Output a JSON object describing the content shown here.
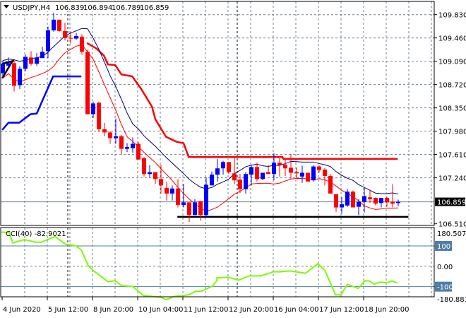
{
  "header": {
    "symbol": "USDJPY,H4",
    "open": "106.839",
    "high": "106.894",
    "low": "106.789",
    "close": "106.859"
  },
  "colors": {
    "bull": "#0000ff",
    "bear": "#ff0000",
    "ma_high": "#000080",
    "ma_low": "#ff0000",
    "cci": "#7cfc00",
    "grid": "#708090",
    "level": "#4d7ea8"
  },
  "chart_data": [
    {
      "type": "candlestick",
      "title": "USDJPY,H4",
      "ylim": [
        106.51,
        109.83
      ],
      "y_ticks": [
        "109.830",
        "109.460",
        "109.090",
        "108.720",
        "108.350",
        "107.980",
        "107.610",
        "107.240",
        "106.859",
        "106.510"
      ],
      "y_tick_values": [
        109.83,
        109.46,
        109.09,
        108.72,
        108.35,
        107.98,
        107.61,
        107.24,
        106.51
      ],
      "current_price": 106.859,
      "x_labels": [
        "4 Jun 2020",
        "5 Jun 12:00",
        "8 Jun 20:00",
        "10 Jun 04:00",
        "11 Jun 12:00",
        "12 Jun 20:00",
        "16 Jun 04:00",
        "17 Jun 12:00",
        "18 Jun 20:00"
      ],
      "x_label_candle_index": [
        0,
        8,
        16,
        24,
        32,
        40,
        48,
        56,
        64
      ],
      "ohlc": [
        [
          108.9,
          109.1,
          108.82,
          109.05
        ],
        [
          109.02,
          109.15,
          108.97,
          109.06
        ],
        [
          109.06,
          109.09,
          108.61,
          108.7
        ],
        [
          108.71,
          109.01,
          108.65,
          108.97
        ],
        [
          108.97,
          109.2,
          108.93,
          109.16
        ],
        [
          109.15,
          109.25,
          109.02,
          109.05
        ],
        [
          109.05,
          109.22,
          109.02,
          109.15
        ],
        [
          109.14,
          109.32,
          109.14,
          109.24
        ],
        [
          109.25,
          109.64,
          109.14,
          109.58
        ],
        [
          109.58,
          109.86,
          109.56,
          109.75
        ],
        [
          109.75,
          109.75,
          109.56,
          109.57
        ],
        [
          109.57,
          109.7,
          109.42,
          109.46
        ],
        [
          109.46,
          109.56,
          109.37,
          109.45
        ],
        [
          109.45,
          109.54,
          109.43,
          109.49
        ],
        [
          109.48,
          109.52,
          109.19,
          109.24
        ],
        [
          109.24,
          109.27,
          108.25,
          108.25
        ],
        [
          108.25,
          108.45,
          108.19,
          108.42
        ],
        [
          108.43,
          108.45,
          107.97,
          108.01
        ],
        [
          108.01,
          108.11,
          107.9,
          107.96
        ],
        [
          107.96,
          107.98,
          107.78,
          107.87
        ],
        [
          107.87,
          108.18,
          107.78,
          107.9
        ],
        [
          107.9,
          107.92,
          107.61,
          107.7
        ],
        [
          107.7,
          107.79,
          107.65,
          107.73
        ],
        [
          107.71,
          107.88,
          107.64,
          107.78
        ],
        [
          107.78,
          107.81,
          107.53,
          107.53
        ],
        [
          107.55,
          107.57,
          107.26,
          107.3
        ],
        [
          107.3,
          107.44,
          107.25,
          107.33
        ],
        [
          107.33,
          107.33,
          107.14,
          107.22
        ],
        [
          107.22,
          107.45,
          106.99,
          107.12
        ],
        [
          107.08,
          107.18,
          106.88,
          106.99
        ],
        [
          106.99,
          107.12,
          106.88,
          107.07
        ],
        [
          107.07,
          107.22,
          106.77,
          106.81
        ],
        [
          106.81,
          107.14,
          106.77,
          106.85
        ],
        [
          106.85,
          106.85,
          106.54,
          106.65
        ],
        [
          106.65,
          106.9,
          106.65,
          106.85
        ],
        [
          106.87,
          106.87,
          106.56,
          106.65
        ],
        [
          106.65,
          107.25,
          106.61,
          107.13
        ],
        [
          107.12,
          107.34,
          107.12,
          107.29
        ],
        [
          107.29,
          107.54,
          107.18,
          107.39
        ],
        [
          107.39,
          107.51,
          107.29,
          107.49
        ],
        [
          107.49,
          107.49,
          107.3,
          107.33
        ],
        [
          107.31,
          107.57,
          107.14,
          107.2
        ],
        [
          107.21,
          107.3,
          107.0,
          107.06
        ],
        [
          107.06,
          107.33,
          106.99,
          107.3
        ],
        [
          107.29,
          107.44,
          107.12,
          107.41
        ],
        [
          107.41,
          107.48,
          107.18,
          107.22
        ],
        [
          107.22,
          107.32,
          107.2,
          107.32
        ],
        [
          107.33,
          107.44,
          107.3,
          107.3
        ],
        [
          107.3,
          107.63,
          107.2,
          107.48
        ],
        [
          107.48,
          107.55,
          107.26,
          107.44
        ],
        [
          107.45,
          107.53,
          107.27,
          107.39
        ],
        [
          107.4,
          107.62,
          107.22,
          107.32
        ],
        [
          107.33,
          107.4,
          107.22,
          107.31
        ],
        [
          107.26,
          107.43,
          107.16,
          107.32
        ],
        [
          107.32,
          107.32,
          107.18,
          107.18
        ],
        [
          107.2,
          107.44,
          107.18,
          107.42
        ],
        [
          107.42,
          107.44,
          107.32,
          107.36
        ],
        [
          107.37,
          107.4,
          107.12,
          107.27
        ],
        [
          107.27,
          107.3,
          106.99,
          106.99
        ],
        [
          106.98,
          106.98,
          106.7,
          106.77
        ],
        [
          106.77,
          106.93,
          106.67,
          106.82
        ],
        [
          106.8,
          107.06,
          106.78,
          107.02
        ],
        [
          107.02,
          107.04,
          106.77,
          106.77
        ],
        [
          106.78,
          106.9,
          106.65,
          106.86
        ],
        [
          106.86,
          107.08,
          106.69,
          106.95
        ],
        [
          106.93,
          107.05,
          106.84,
          106.9
        ],
        [
          106.92,
          106.93,
          106.8,
          106.83
        ],
        [
          106.84,
          106.92,
          106.77,
          106.92
        ],
        [
          106.92,
          106.94,
          106.78,
          106.85
        ],
        [
          106.86,
          107.14,
          106.77,
          106.83
        ],
        [
          106.839,
          106.894,
          106.789,
          106.859
        ]
      ],
      "overlays": {
        "thick_red": [
          [
            14.9,
            109.38
          ],
          [
            16.6,
            109.29
          ],
          [
            17.9,
            109.18
          ],
          [
            18.6,
            109.04
          ],
          [
            19.9,
            109.03
          ],
          [
            21,
            108.88
          ],
          [
            22.9,
            108.85
          ],
          [
            24.5,
            108.65
          ],
          [
            26.4,
            108.37
          ],
          [
            27,
            108.17
          ],
          [
            28.9,
            107.89
          ],
          [
            30.8,
            107.81
          ],
          [
            32,
            107.79
          ],
          [
            32.9,
            107.57
          ],
          [
            49.5,
            107.57
          ],
          [
            49.7,
            107.54
          ],
          [
            69.9,
            107.54
          ]
        ],
        "thick_blue": [
          [
            -0.1,
            108.0
          ],
          [
            1,
            108.115
          ],
          [
            2.9,
            108.115
          ],
          [
            4.9,
            108.25
          ],
          [
            6,
            108.26
          ],
          [
            8.9,
            108.85
          ],
          [
            13.9,
            108.85
          ]
        ],
        "black_lines": [
          [
            [
              -0.1,
              108.82
            ],
            [
              1.75,
              109.1
            ]
          ],
          [
            [
              -0.1,
              109.05
            ],
            [
              2,
              109.1
            ]
          ]
        ],
        "support_line": {
          "price": 106.62,
          "from_index": 30.9,
          "to_index": 71.8
        }
      },
      "period_separators_index": [
        11,
        41
      ]
    },
    {
      "type": "line",
      "title": "CCI(40)",
      "current_value": "-82.9021",
      "label": "CCI(40) -82.9021",
      "ylim": [
        -180.8812,
        180.5073
      ],
      "y_ticks": [
        "180.5073",
        "100",
        "0.00",
        "-100",
        "-180.8812"
      ],
      "levels": [
        100,
        -100
      ],
      "points": [
        [
          -0.25,
          167
        ],
        [
          1.1,
          167
        ],
        [
          1.75,
          115
        ],
        [
          3.9,
          131
        ],
        [
          5.75,
          118
        ],
        [
          6.75,
          118
        ],
        [
          9.25,
          146
        ],
        [
          11.1,
          108
        ],
        [
          12.9,
          101
        ],
        [
          13.9,
          80
        ],
        [
          15.1,
          4
        ],
        [
          16.1,
          -23
        ],
        [
          18.6,
          -75
        ],
        [
          19.9,
          -71
        ],
        [
          21,
          -95
        ],
        [
          23,
          -99
        ],
        [
          24.9,
          -144
        ],
        [
          27.9,
          -151
        ],
        [
          28.9,
          -164
        ],
        [
          30.4,
          -148
        ],
        [
          32.9,
          -140
        ],
        [
          34.1,
          -123
        ],
        [
          35.1,
          -123
        ],
        [
          37,
          -99
        ],
        [
          37.9,
          -71
        ],
        [
          37.9,
          -71
        ],
        [
          37.9,
          -57
        ],
        [
          39.9,
          -54
        ],
        [
          41.75,
          -68
        ],
        [
          43.6,
          -47
        ],
        [
          45.75,
          -47
        ],
        [
          47.9,
          -27
        ],
        [
          49.1,
          -27
        ],
        [
          50.75,
          -23
        ],
        [
          53.6,
          -34
        ],
        [
          55.75,
          12
        ],
        [
          57,
          -19
        ],
        [
          58.9,
          -140
        ],
        [
          59.9,
          -140
        ],
        [
          61,
          -88
        ],
        [
          62.9,
          -109
        ],
        [
          64.1,
          -71
        ],
        [
          64.9,
          -72
        ],
        [
          65.75,
          -88
        ],
        [
          66.75,
          -78
        ],
        [
          68,
          -81
        ],
        [
          68.9,
          -72
        ],
        [
          69.9,
          -83
        ]
      ]
    }
  ]
}
